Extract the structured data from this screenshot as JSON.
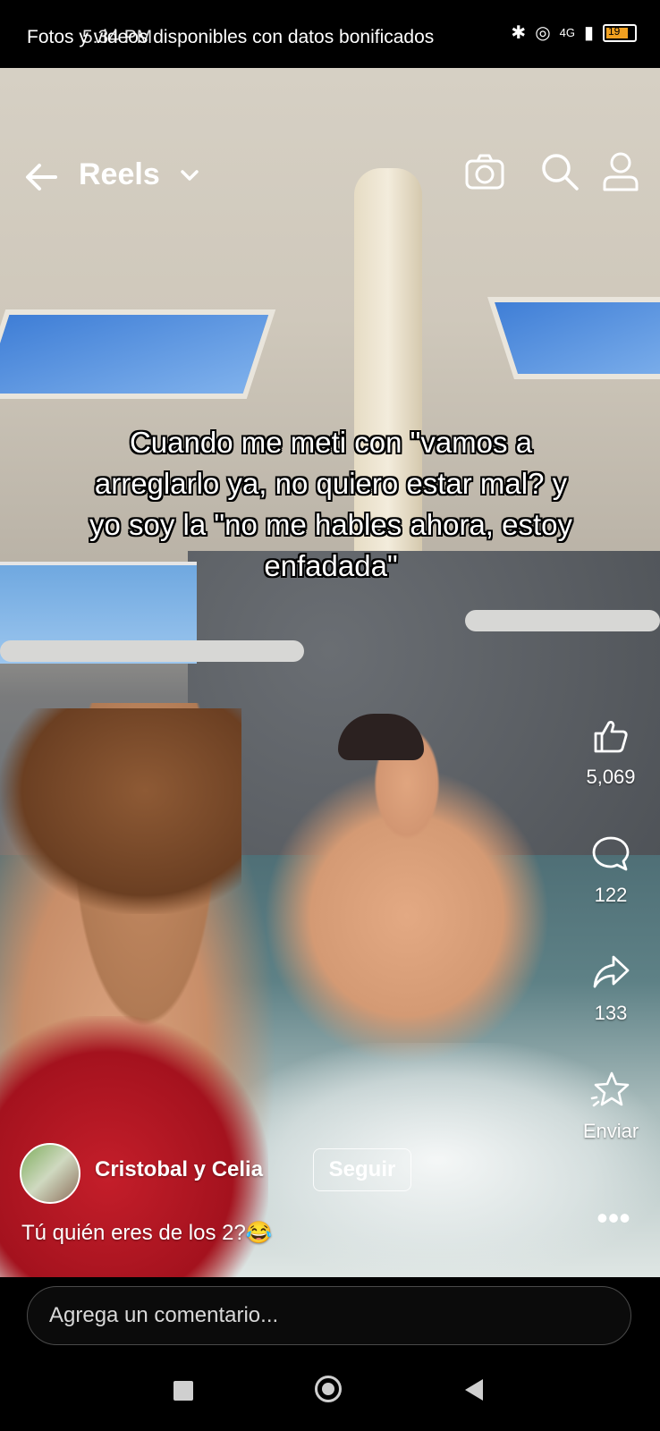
{
  "status_bar": {
    "notification": "Fotos y videos disponibles con datos bonificados",
    "time": "5:34 PM",
    "network": "4G",
    "battery": "19"
  },
  "header": {
    "title": "Reels"
  },
  "video": {
    "caption_overlay": "Cuando me meti con \"vamos a arreglarlo ya, no quiero estar mal? y yo soy la \"no me hables ahora, estoy enfadada\""
  },
  "actions": {
    "likes": "5,069",
    "comments": "122",
    "shares": "133",
    "send_label": "Enviar"
  },
  "author": {
    "name": "Cristobal y Celia",
    "follow_label": "Seguir"
  },
  "post": {
    "caption": "Tú quién eres de los 2?😂"
  },
  "comment": {
    "placeholder": "Agrega un comentario..."
  }
}
